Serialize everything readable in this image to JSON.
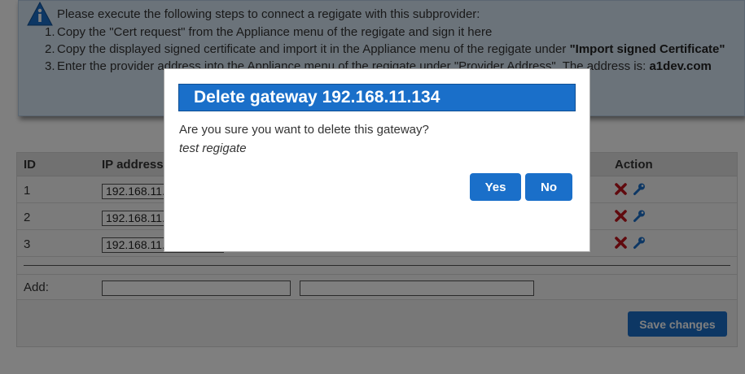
{
  "info": {
    "intro": "Please execute the following steps to connect a regigate with this subprovider:",
    "steps": [
      {
        "num": "1.",
        "text": "Copy the \"Cert request\" from the Appliance menu of the regigate and sign it here",
        "bold": ""
      },
      {
        "num": "2.",
        "text": "Copy the displayed signed certificate and import it in the Appliance menu of the regigate under ",
        "bold": "\"Import signed Certificate\""
      },
      {
        "num": "3.",
        "text": "Enter the provider address into the Appliance menu of the regigate under \"Provider Address\". The address is: ",
        "bold": "a1dev.com"
      }
    ]
  },
  "table": {
    "headers": {
      "id": "ID",
      "ip": "IP address",
      "action": "Action"
    },
    "rows": [
      {
        "id": "1",
        "ip": "192.168.11.131"
      },
      {
        "id": "2",
        "ip": "192.168.11.134"
      },
      {
        "id": "3",
        "ip": "192.168.11.135"
      }
    ],
    "add_label": "Add:",
    "save_label": "Save changes"
  },
  "icons": {
    "delete": "delete-x-icon",
    "edit": "key-edit-icon",
    "info": "info-icon"
  },
  "colors": {
    "accent": "#1a6fc9",
    "delete": "#c0141c",
    "info_bg": "#d7e6f5"
  },
  "modal": {
    "title": "Delete gateway 192.168.11.134",
    "question": "Are you sure you want to delete this gateway?",
    "name": "test regigate",
    "yes_label": "Yes",
    "no_label": "No"
  }
}
